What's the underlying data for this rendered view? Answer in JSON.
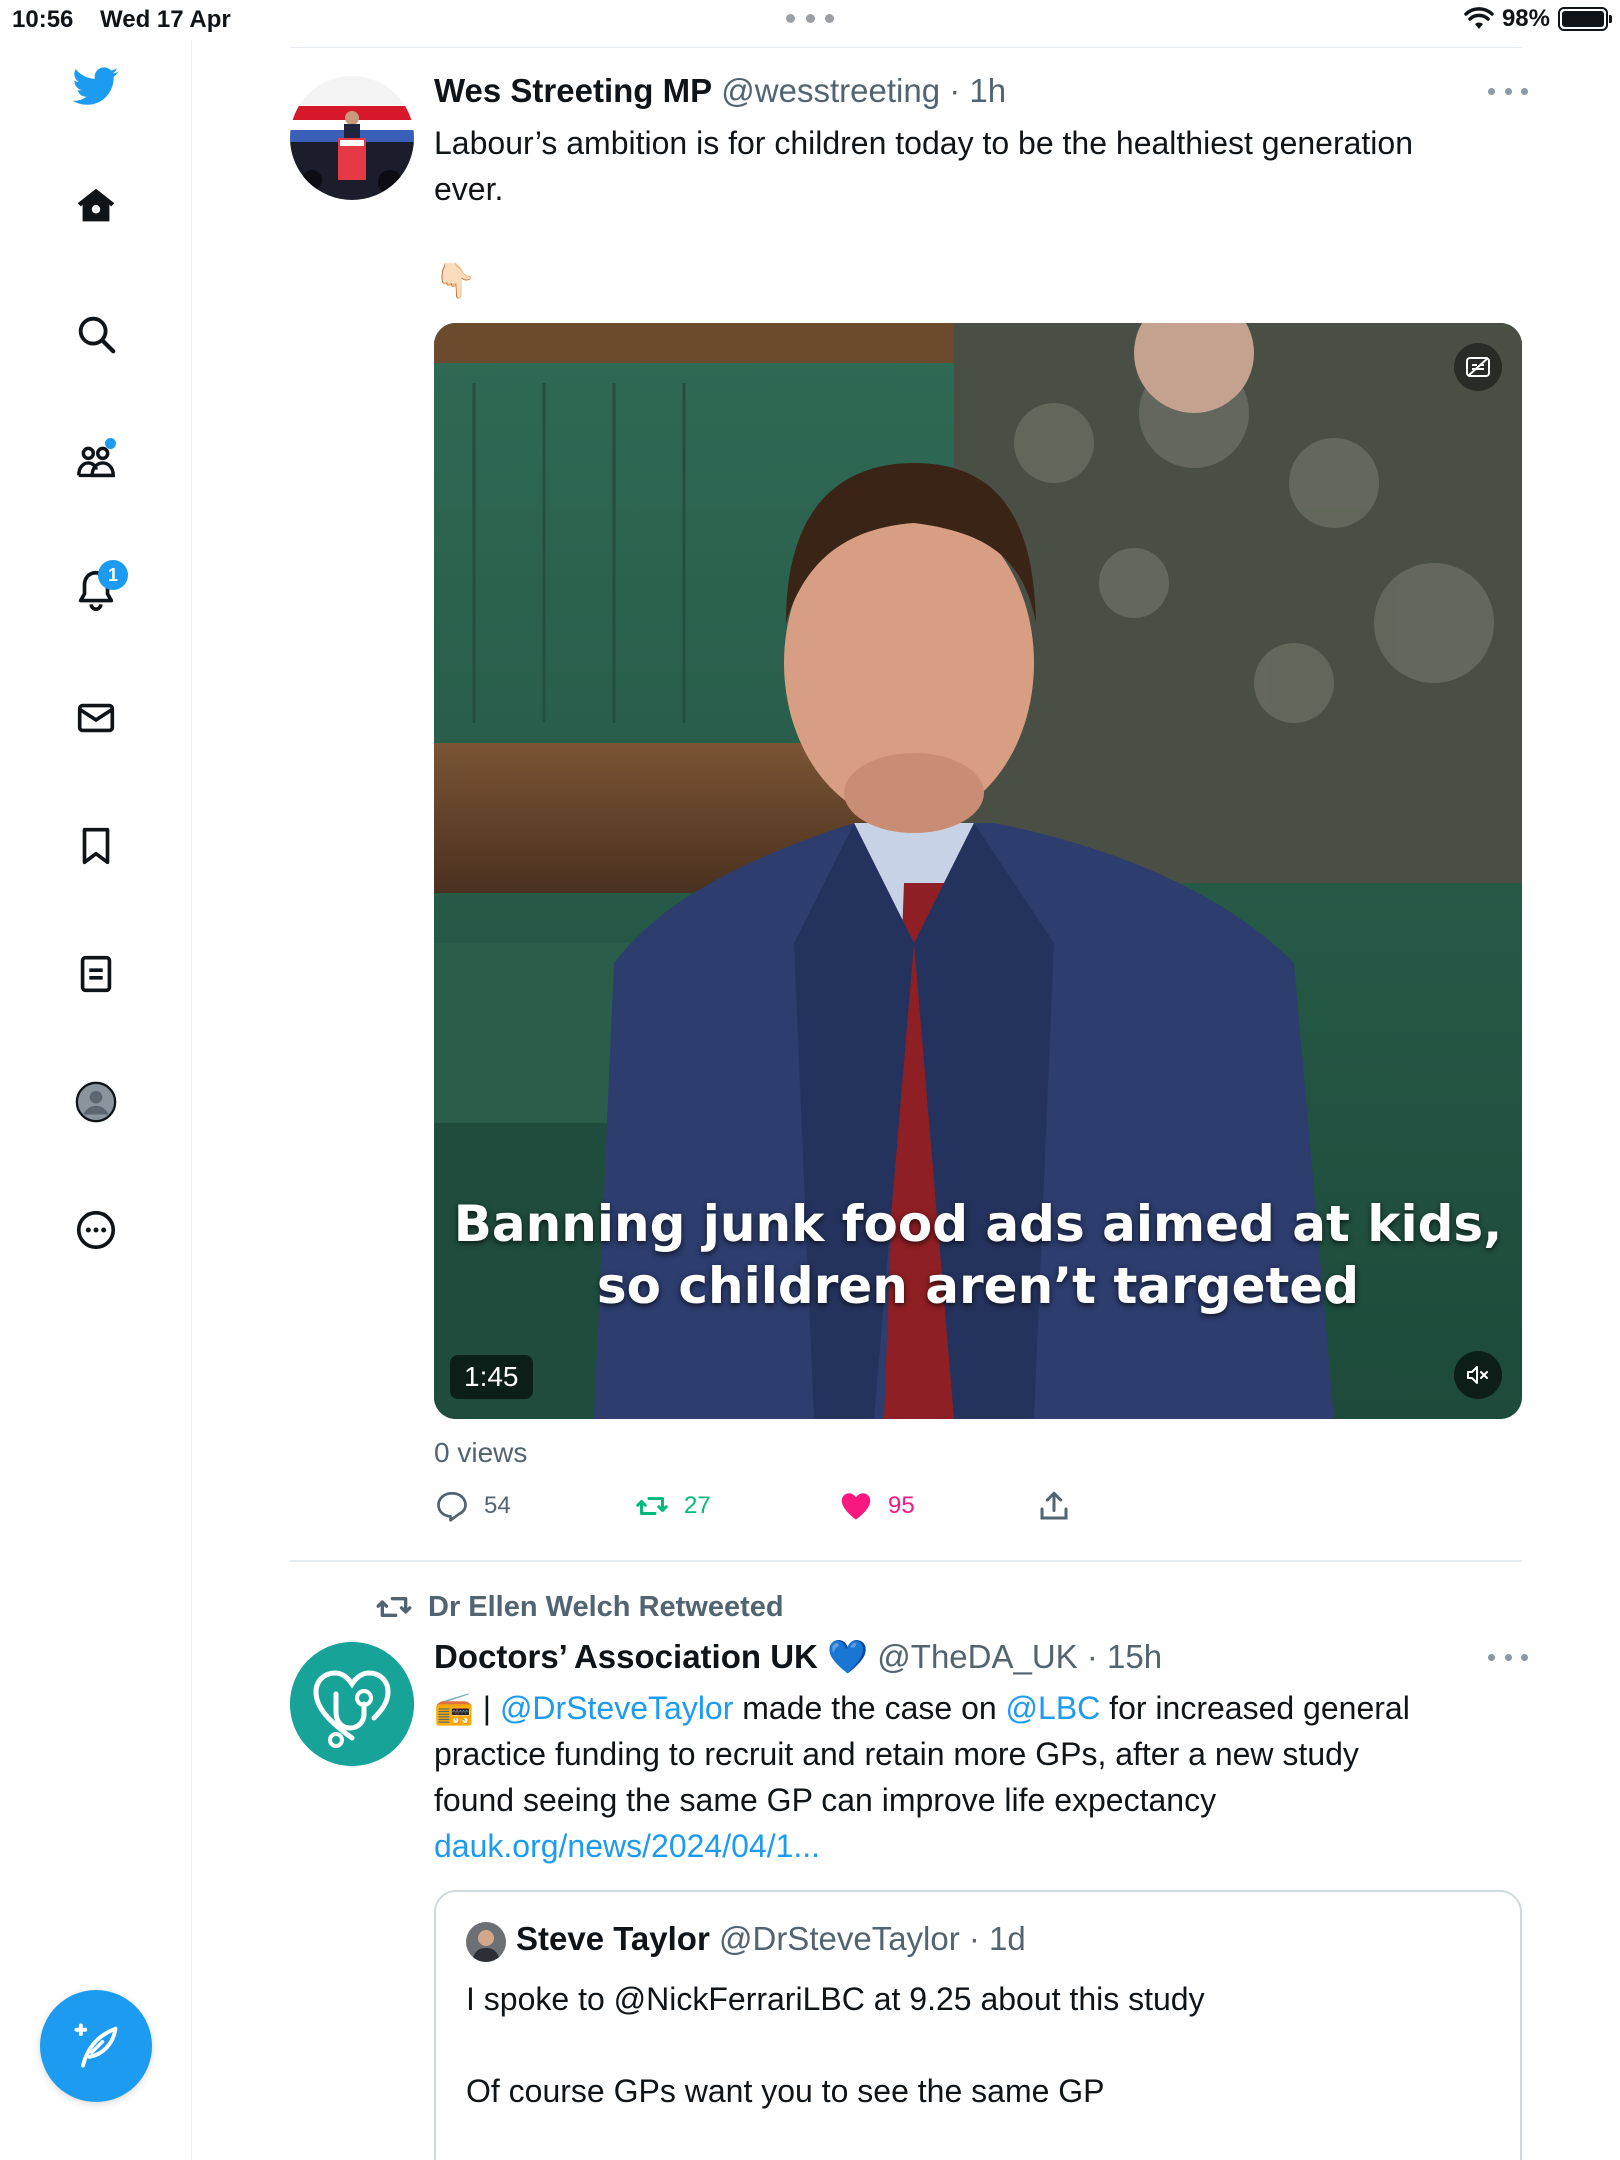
{
  "status_bar": {
    "time": "10:56",
    "date": "Wed 17 Apr",
    "battery": "98%",
    "battery_level": 0.98
  },
  "sidebar": {
    "logo": "twitter-bird-icon",
    "items": [
      {
        "name": "home",
        "icon": "home-icon"
      },
      {
        "name": "explore",
        "icon": "search-icon"
      },
      {
        "name": "communities",
        "icon": "communities-icon"
      },
      {
        "name": "notifications",
        "icon": "bell-icon",
        "badge": "1"
      },
      {
        "name": "messages",
        "icon": "mail-icon"
      },
      {
        "name": "bookmarks",
        "icon": "bookmark-icon"
      },
      {
        "name": "lists",
        "icon": "list-icon"
      },
      {
        "name": "profile",
        "icon": "avatar-icon"
      },
      {
        "name": "more",
        "icon": "more-circle-icon"
      }
    ],
    "compose_icon": "compose-icon"
  },
  "tweets": [
    {
      "name": "Wes Streeting MP",
      "handle": "@wesstreeting",
      "time": "· 1h",
      "text_line1": "Labour’s ambition is for children today to be the healthiest generation",
      "text_line2": "ever.",
      "emoji": "👇🏻",
      "video": {
        "caption_line1": "Banning junk food ads aimed at kids,",
        "caption_line2": "so children aren’t targeted",
        "duration": "1:45"
      },
      "views": "0 views",
      "replies": "54",
      "retweets": "27",
      "likes": "95"
    },
    {
      "retweeted_by": "Dr Ellen Welch Retweeted",
      "name": "Doctors’ Association UK",
      "verified_emoji": "💙",
      "handle": "@TheDA_UK",
      "time": "· 15h",
      "emoji": "📻",
      "text_sep": " | ",
      "mention1": "@DrSteveTaylor",
      "text_a": " made the case on ",
      "mention2": "@LBC",
      "text_b": " for increased general",
      "line2": "practice funding to recruit and retain more GPs, after a new study",
      "line3": "found seeing the same GP can improve life expectancy",
      "link": "dauk.org/news/2024/04/1...",
      "quote": {
        "name": "Steve Taylor",
        "handle": "@DrSteveTaylor",
        "time": "· 1d",
        "text": "I spoke to @NickFerrariLBC at 9.25 about this study\n\nOf course GPs want you to see the same GP"
      }
    }
  ],
  "colors": {
    "accent": "#1d9bf0",
    "retweet": "#00ba7c",
    "like": "#f91880",
    "muted": "#536471",
    "avatar_teal": "#17a398"
  }
}
